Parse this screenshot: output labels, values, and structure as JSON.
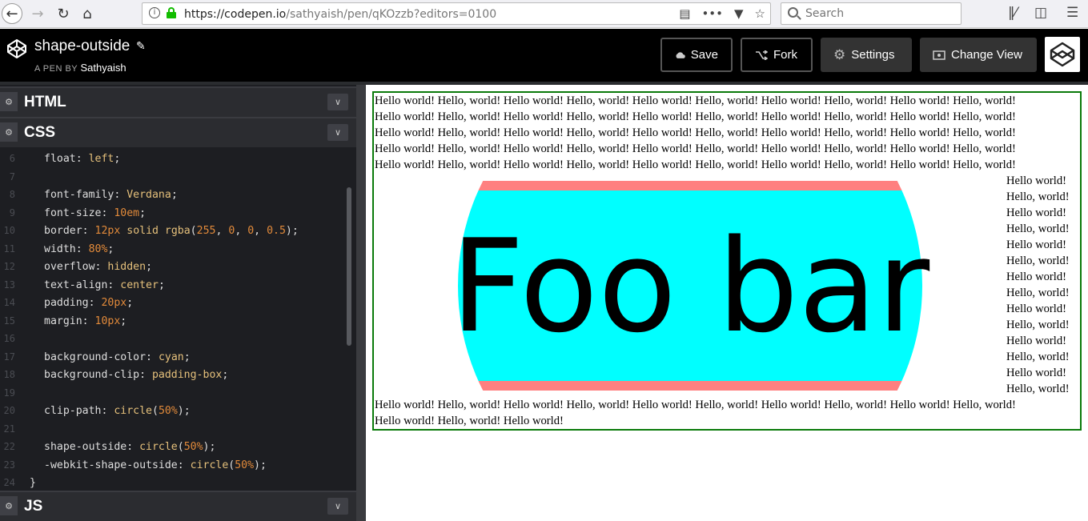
{
  "browser": {
    "url_host": "https://codepen.io",
    "url_path": "/sathyaish/pen/qKOzzb?editors=0100",
    "search_placeholder": "Search"
  },
  "header": {
    "pen_title": "shape-outside",
    "pen_by_label": "A PEN BY",
    "author": "Sathyaish",
    "save_label": "Save",
    "fork_label": "Fork",
    "settings_label": "Settings",
    "change_view_label": "Change View"
  },
  "editors": {
    "html_title": "HTML",
    "css_title": "CSS",
    "js_title": "JS",
    "css_lines": [
      {
        "num": "6",
        "prop": "float",
        "value": "left",
        "value_kind": "v"
      },
      {
        "num": "7",
        "prop": "",
        "value": "",
        "value_kind": ""
      },
      {
        "num": "8",
        "prop": "font-family",
        "value": "Verdana",
        "value_kind": "v"
      },
      {
        "num": "9",
        "prop": "font-size",
        "value": "10em",
        "value_kind": "n"
      },
      {
        "num": "10",
        "prop": "border",
        "value": "12px solid rgba(255, 0, 0, 0.5)",
        "value_kind": "mixed"
      },
      {
        "num": "11",
        "prop": "width",
        "value": "80%",
        "value_kind": "n"
      },
      {
        "num": "12",
        "prop": "overflow",
        "value": "hidden",
        "value_kind": "v"
      },
      {
        "num": "13",
        "prop": "text-align",
        "value": "center",
        "value_kind": "v"
      },
      {
        "num": "14",
        "prop": "padding",
        "value": "20px",
        "value_kind": "n"
      },
      {
        "num": "15",
        "prop": "margin",
        "value": "10px",
        "value_kind": "n"
      },
      {
        "num": "16",
        "prop": "",
        "value": "",
        "value_kind": ""
      },
      {
        "num": "17",
        "prop": "background-color",
        "value": "cyan",
        "value_kind": "v"
      },
      {
        "num": "18",
        "prop": "background-clip",
        "value": "padding-box",
        "value_kind": "v"
      },
      {
        "num": "19",
        "prop": "",
        "value": "",
        "value_kind": ""
      },
      {
        "num": "20",
        "prop": "clip-path",
        "value": "circle(50%)",
        "value_kind": "func"
      },
      {
        "num": "21",
        "prop": "",
        "value": "",
        "value_kind": ""
      },
      {
        "num": "22",
        "prop": "shape-outside",
        "value": "circle(50%)",
        "value_kind": "func"
      },
      {
        "num": "23",
        "prop": "-webkit-shape-outside",
        "value": "circle(50%)",
        "value_kind": "func"
      },
      {
        "num": "24",
        "prop": "}",
        "value": "",
        "value_kind": "close"
      }
    ]
  },
  "preview": {
    "full_lines": [
      "Hello world! Hello, world! Hello world! Hello, world! Hello world! Hello, world! Hello world! Hello, world! Hello world! Hello, world!",
      "Hello world! Hello, world! Hello world! Hello, world! Hello world! Hello, world! Hello world! Hello, world! Hello world! Hello, world!",
      "Hello world! Hello, world! Hello world! Hello, world! Hello world! Hello, world! Hello world! Hello, world! Hello world! Hello, world!",
      "Hello world! Hello, world! Hello world! Hello, world! Hello world! Hello, world! Hello world! Hello, world! Hello world! Hello, world!",
      "Hello world! Hello, world! Hello world! Hello, world! Hello world! Hello, world! Hello world! Hello, world! Hello world! Hello, world!"
    ],
    "side_lines": [
      "Hello world!",
      "Hello, world!",
      "Hello world!",
      "Hello, world!",
      "Hello world!",
      "Hello, world!",
      "Hello world!",
      "Hello, world!",
      "Hello world!",
      "Hello, world!",
      "Hello world!",
      "Hello, world!",
      "Hello world!",
      "Hello, world!"
    ],
    "bottom_lines": [
      "Hello world! Hello, world! Hello world! Hello, world! Hello world! Hello, world! Hello world! Hello, world! Hello world! Hello, world!",
      "Hello world! Hello, world! Hello world!"
    ],
    "shape_text": "Foo bar",
    "colors": {
      "shape_bg": "#00ffff",
      "shape_border": "#ff8080",
      "outer_border": "#0a7a0a"
    }
  }
}
